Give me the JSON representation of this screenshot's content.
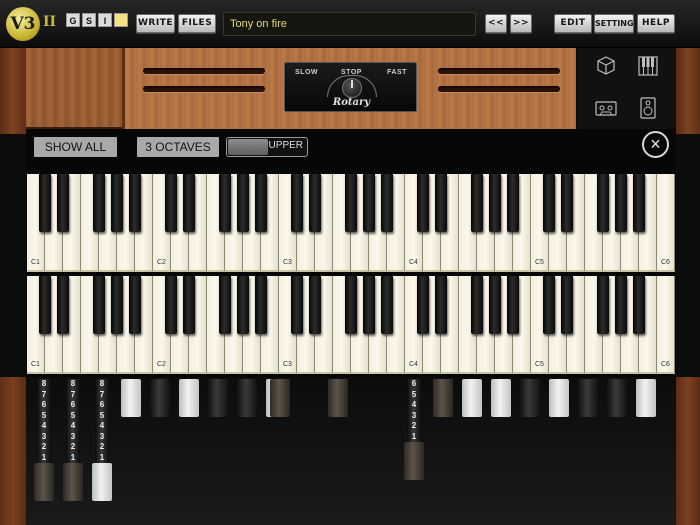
{
  "toolbar": {
    "logo_text": "V3",
    "logo_roman": "II",
    "pages": [
      "G",
      "S",
      "I",
      ""
    ],
    "write_label": "WRITE",
    "files_label": "FILES",
    "preset_name": "Tony on fire",
    "prev_label": "<<",
    "next_label": ">>",
    "edit_label": "EDIT",
    "settings_label": "SETTINGS",
    "help_label": "HELP"
  },
  "rotary": {
    "slow_label": "SLOW",
    "stop_label": "STOP",
    "fast_label": "FAST",
    "name": "Rotary"
  },
  "tools": [
    "cube-icon",
    "keyboard-icon",
    "cassette-icon",
    "speaker-icon"
  ],
  "controls": {
    "show_all_label": "SHOW ALL",
    "octaves_label": "3 OCTAVES",
    "manual_label": "UPPER",
    "close_symbol": "×"
  },
  "keyboards": [
    {
      "name": "upper",
      "octave_labels": [
        "C1",
        "C2",
        "C3",
        "C4",
        "C5",
        "C6"
      ]
    },
    {
      "name": "lower",
      "octave_labels": [
        "C1",
        "C2",
        "C3",
        "C4",
        "C5",
        "C6"
      ]
    }
  ],
  "drawbars": {
    "scale": [
      "8",
      "7",
      "6",
      "5",
      "4",
      "3",
      "2",
      "1"
    ],
    "upper_settings": [
      8,
      8,
      8,
      0,
      0,
      0,
      0,
      0,
      0
    ],
    "pedal_settings": [
      0,
      0
    ],
    "lower_settings": [
      6,
      0,
      0,
      0,
      0,
      0,
      0,
      0,
      0
    ],
    "colors": {
      "dark": "#4a423a",
      "black": "#222222",
      "white": "#eeeeee"
    }
  }
}
